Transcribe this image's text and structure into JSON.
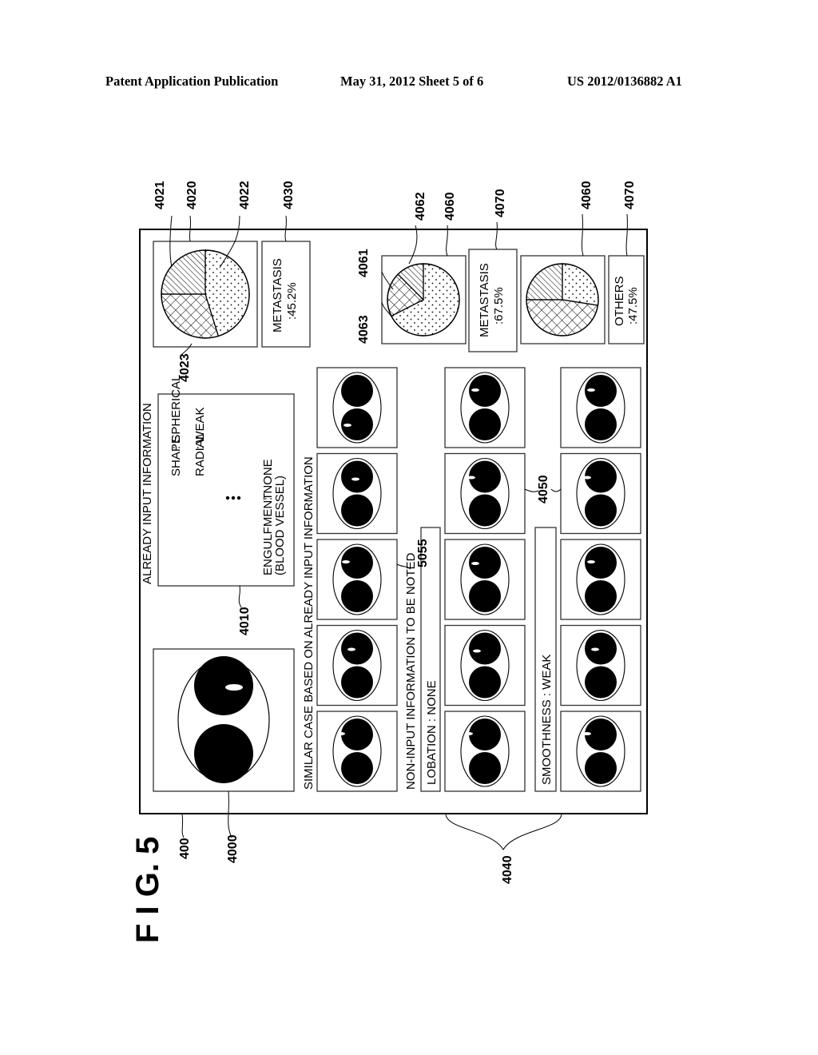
{
  "header": {
    "left": "Patent Application Publication",
    "middle": "May 31, 2012   Sheet 5 of 6",
    "right": "US 2012/0136882 A1"
  },
  "figure": {
    "title": "F I G.  5",
    "refs": {
      "screen": "400",
      "main_image": "4000",
      "input_info": "4010",
      "pie_main": "4020",
      "pie_slice_a": "4021",
      "pie_slice_b": "4022",
      "pie_slice_c": "4023",
      "result_main": "4030",
      "similar_cases": "4040",
      "case_thumb": "4050",
      "pie_case": "4060",
      "pie_case_a": "4061",
      "pie_case_b": "4062",
      "pie_case_c": "4063",
      "result_case": "4070",
      "note_box": "5055"
    },
    "already_input": {
      "title": "ALREADY INPUT INFORMATION",
      "rows": [
        {
          "key": "SHAPE",
          "value": ": SPHERICAL"
        },
        {
          "key": "RADIAL",
          "value": ": WEAK"
        }
      ],
      "ellipsis": "⋮",
      "last_key_1": "ENGULFMENT",
      "last_key_2": "(BLOOD VESSEL)",
      "last_value": ": NONE"
    },
    "main_result": {
      "label": "METASTASIS",
      "value": ":45.2%"
    },
    "similar_header": "SIMILAR CASE BASED ON ALREADY INPUT INFORMATION",
    "non_input_header": "NON-INPUT INFORMATION TO BE NOTED",
    "lobation": "LOBATION : NONE",
    "smoothness": "SMOOTHNESS : WEAK",
    "case_result_1": {
      "label": "METASTASIS",
      "value": ":67.5%"
    },
    "case_result_2": {
      "label": "OTHERS",
      "value": ":47.5%"
    }
  },
  "chart_data": [
    {
      "type": "pie",
      "title": "4020",
      "slices": [
        {
          "name": "4022 (dotted)",
          "value": 45.2,
          "pattern": "dots"
        },
        {
          "name": "4023 (cross-hatched)",
          "value": 29.8,
          "pattern": "crosshatch"
        },
        {
          "name": "4021 (diagonal)",
          "value": 25.0,
          "pattern": "diagonal"
        }
      ],
      "annotation": "METASTASIS :45.2%"
    },
    {
      "type": "pie",
      "title": "4060 (lobation)",
      "slices": [
        {
          "name": "4062 (dotted)",
          "value": 67.5,
          "pattern": "dots"
        },
        {
          "name": "4063 (cross-hatched)",
          "value": 20.0,
          "pattern": "crosshatch"
        },
        {
          "name": "4061 (diagonal)",
          "value": 12.5,
          "pattern": "diagonal"
        }
      ],
      "annotation": "METASTASIS :67.5%"
    },
    {
      "type": "pie",
      "title": "4060 (smoothness)",
      "slices": [
        {
          "name": "dotted",
          "value": 27.5,
          "pattern": "dots"
        },
        {
          "name": "cross-hatched",
          "value": 47.5,
          "pattern": "crosshatch"
        },
        {
          "name": "diagonal",
          "value": 25.0,
          "pattern": "diagonal"
        }
      ],
      "annotation": "OTHERS :47.5%"
    }
  ]
}
